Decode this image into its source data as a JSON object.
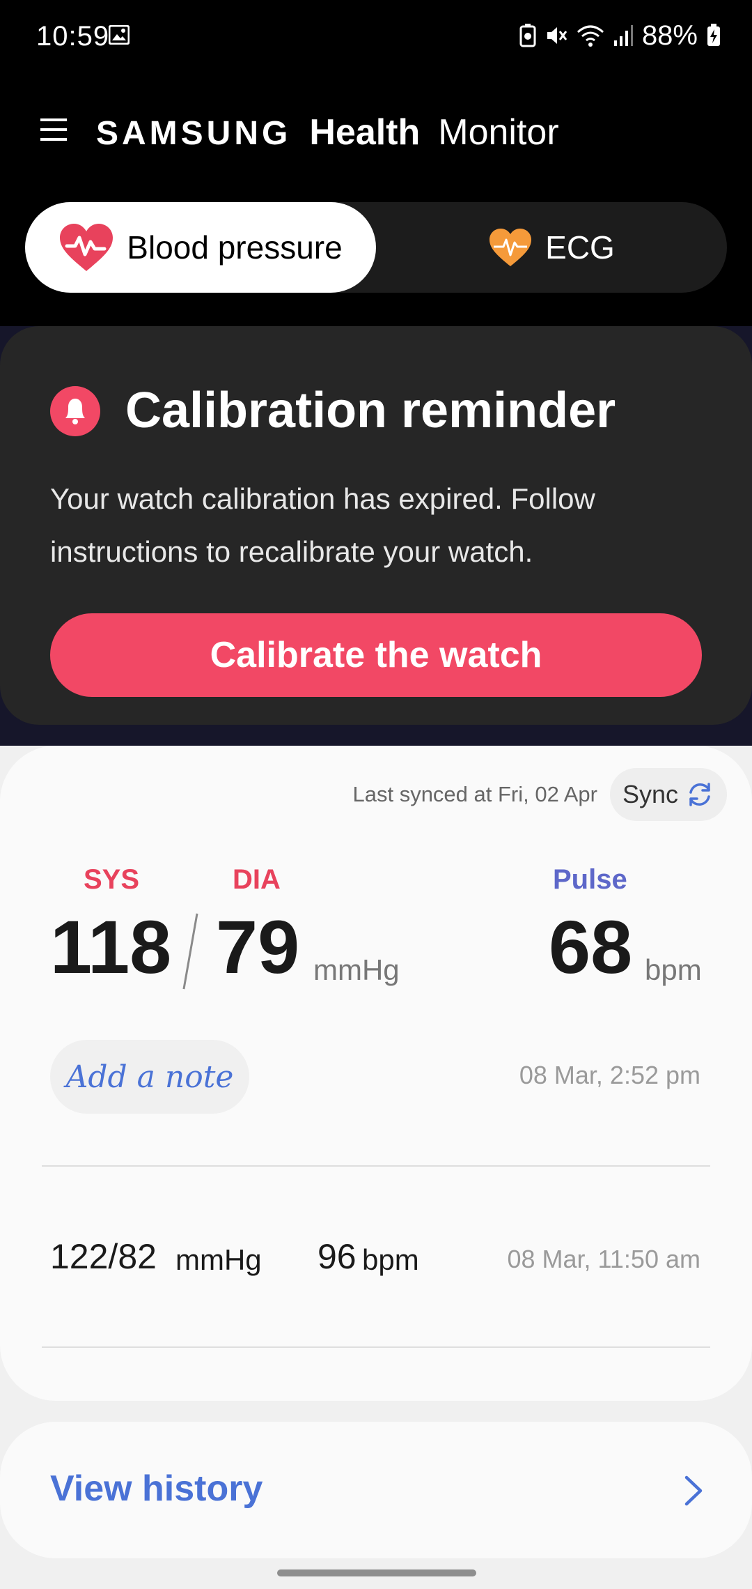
{
  "status_bar": {
    "time": "10:59",
    "battery_text": "88%"
  },
  "header": {
    "brand_samsung": "SAMSUNG",
    "brand_health": "Health",
    "brand_monitor": "Monitor"
  },
  "tabs": [
    {
      "label": "Blood pressure",
      "selected": true
    },
    {
      "label": "ECG",
      "selected": false
    }
  ],
  "calibration": {
    "title": "Calibration reminder",
    "description": "Your watch calibration has expired. Follow instructions to recalibrate your watch.",
    "button_label": "Calibrate the watch"
  },
  "reading": {
    "last_synced": "Last synced at Fri, 02 Apr",
    "sync_label": "Sync",
    "sys_label": "SYS",
    "dia_label": "DIA",
    "pulse_label": "Pulse",
    "sys_value": "118",
    "dia_value": "79",
    "bp_unit": "mmHg",
    "pulse_value": "68",
    "pulse_unit": "bpm",
    "note_button": "Add a note",
    "timestamp": "08 Mar, 2:52 pm"
  },
  "history_items": [
    {
      "bp": "122/82",
      "bp_unit": "mmHg",
      "pulse": "96",
      "pulse_unit": "bpm",
      "timestamp": "08 Mar, 11:50 am"
    }
  ],
  "view_history": {
    "label": "View history"
  },
  "colors": {
    "accent_red": "#f24865",
    "label_red": "#e8425c",
    "pulse_purple": "#5d67c9",
    "link_blue": "#4a72d6",
    "ecg_orange": "#f59a3a"
  }
}
